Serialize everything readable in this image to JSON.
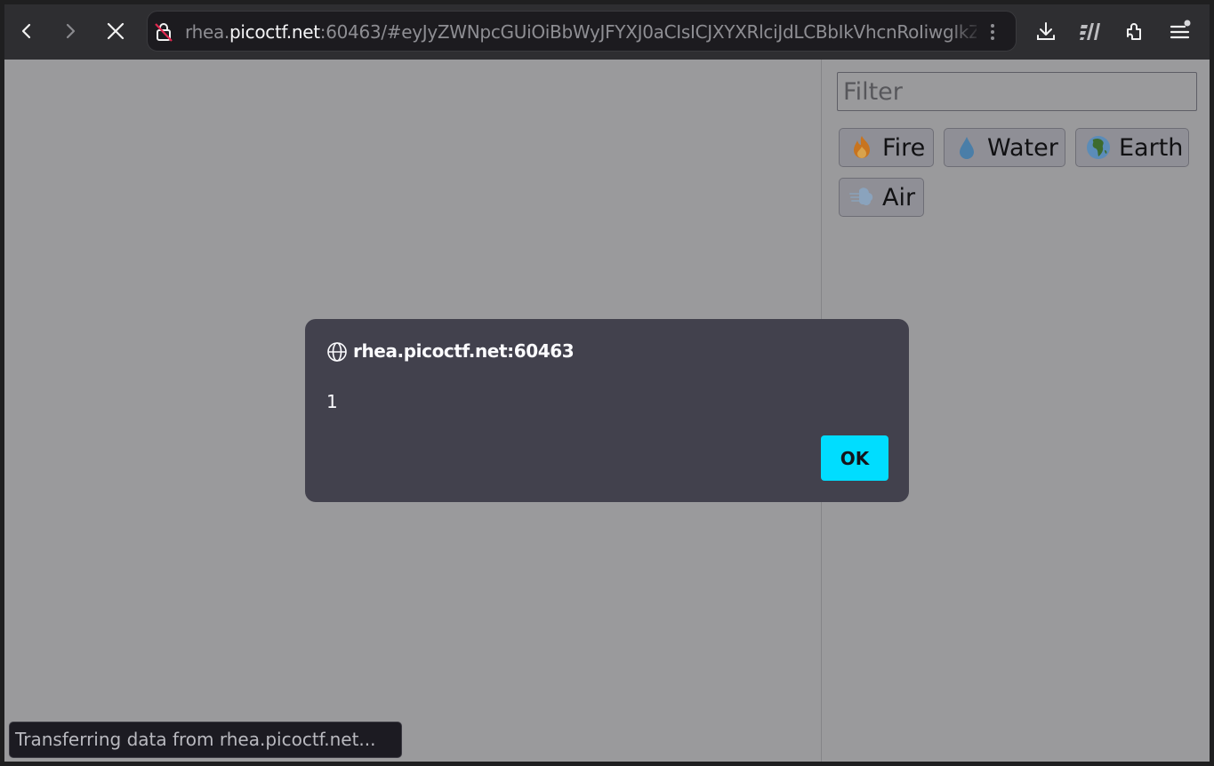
{
  "browser": {
    "nav": {
      "back_label": "Back",
      "forward_label": "Forward",
      "stop_label": "Stop"
    },
    "url": {
      "prefix": "rhea.",
      "host": "picoctf.net",
      "rest": ":60463/#eyJyZWNpcGUiOiBbWyJFYXJ0aCIsICJXYXRlciJdLCBbIkVhcnRoIiwgIkZ"
    },
    "toolbar_icons": [
      "download-icon",
      "reader-icon",
      "extensions-icon",
      "menu-icon"
    ],
    "status_text": "Transferring data from rhea.picoctf.net..."
  },
  "page": {
    "filter": {
      "placeholder": "Filter",
      "value": ""
    },
    "elements": [
      {
        "label": "Fire",
        "emoji": "fire"
      },
      {
        "label": "Water",
        "emoji": "droplet"
      },
      {
        "label": "Earth",
        "emoji": "globe-africa"
      },
      {
        "label": "Air",
        "emoji": "wind"
      }
    ]
  },
  "dialog": {
    "origin": "rhea.picoctf.net:60463",
    "message": "1",
    "ok_label": "OK"
  },
  "colors": {
    "accent": "#00ddff",
    "dialog_bg": "#42414d",
    "overlay_page": "#9a9a9c"
  }
}
